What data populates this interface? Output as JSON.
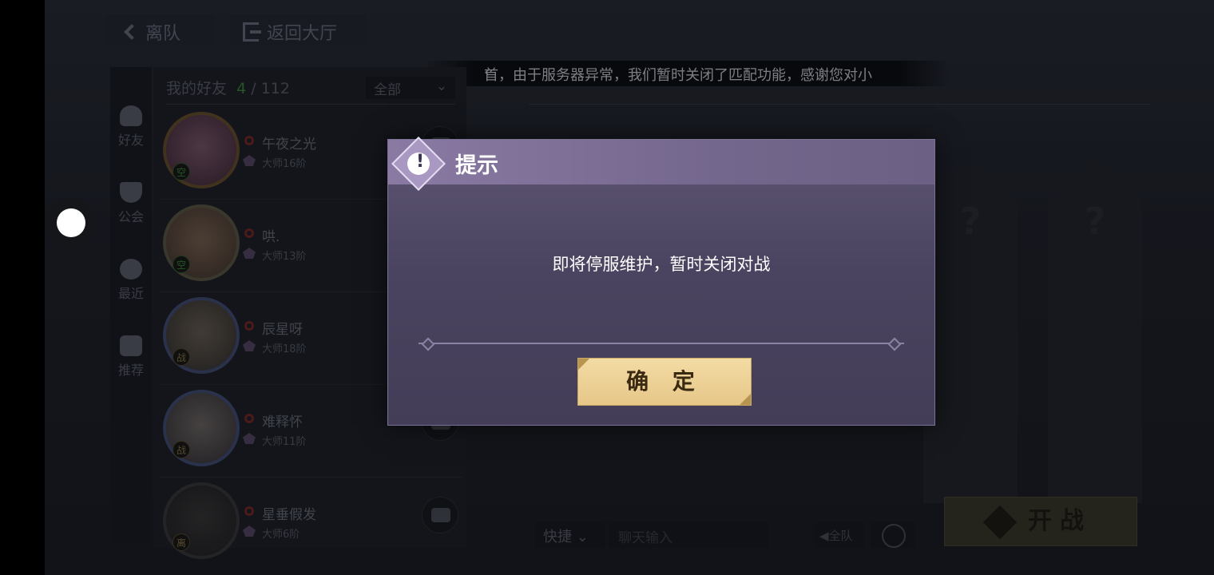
{
  "top_bar": {
    "leave_label": "离队",
    "lobby_label": "返回大厅"
  },
  "announcement": {
    "text": "首，由于服务器异常，我们暂时关闭了匹配功能，感谢您对小"
  },
  "side_tabs": [
    {
      "label": "好友",
      "icon": "friends-icon"
    },
    {
      "label": "公会",
      "icon": "guild-icon"
    },
    {
      "label": "最近",
      "icon": "clock-icon"
    },
    {
      "label": "推荐",
      "icon": "thumbs-up-icon"
    }
  ],
  "friends_panel": {
    "title": "我的好友",
    "online_count": "4",
    "total_count": "/ 112",
    "filter_value": "全部",
    "friends": [
      {
        "name": "午夜之光",
        "rank": "大师16阶",
        "status": "空"
      },
      {
        "name": "哄.",
        "rank": "大师13阶",
        "status": "空"
      },
      {
        "name": "辰星呀",
        "rank": "大师18阶",
        "status": "战"
      },
      {
        "name": "难释怀",
        "rank": "大师11阶",
        "status": "战"
      },
      {
        "name": "星垂假发",
        "rank": "大师6阶",
        "status": "离"
      }
    ]
  },
  "slots": {
    "placeholder": "?"
  },
  "bottom_bar": {
    "quick_label": "快捷",
    "chat_placeholder": "聊天输入",
    "team_voice_label": "全队",
    "fight_label": "开战"
  },
  "dialog": {
    "title": "提示",
    "message": "即将停服维护，暂时关闭对战",
    "confirm_label": "确 定",
    "badge_mark": "!"
  }
}
